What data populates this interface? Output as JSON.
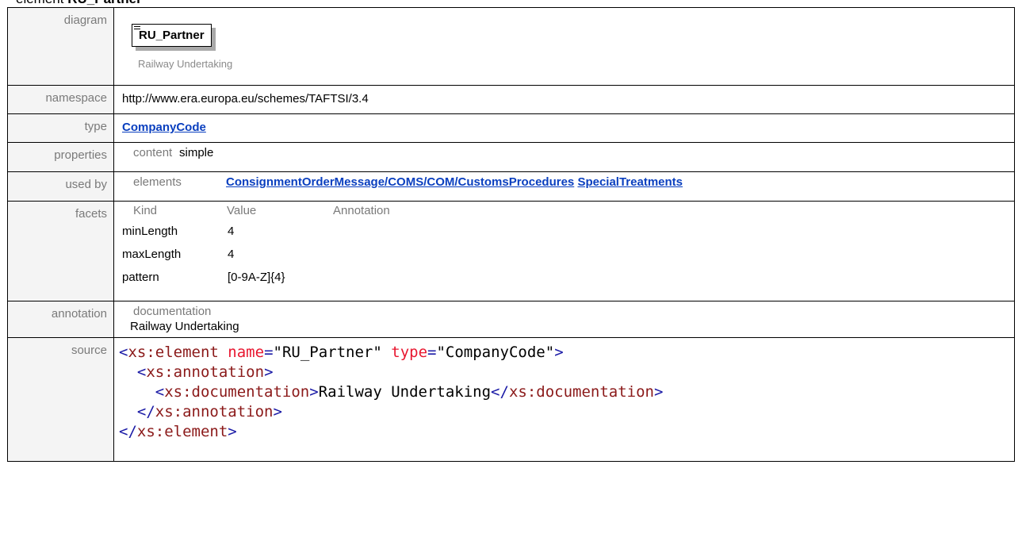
{
  "heading": {
    "prefix": "element",
    "name": "RU_Partner"
  },
  "rows": {
    "diagram": {
      "label": "diagram",
      "box_name": "RU_Partner",
      "caption": "Railway Undertaking"
    },
    "namespace": {
      "label": "namespace",
      "value": "http://www.era.europa.eu/schemes/TAFTSI/3.4"
    },
    "type": {
      "label": "type",
      "value": "CompanyCode"
    },
    "properties": {
      "label": "properties",
      "key": "content",
      "value": "simple"
    },
    "used_by": {
      "label": "used by",
      "key": "elements",
      "links": [
        "ConsignmentOrderMessage/COMS/COM/CustomsProcedures",
        "SpecialTreatments"
      ]
    },
    "facets": {
      "label": "facets",
      "headers": {
        "kind": "Kind",
        "value": "Value",
        "annotation": "Annotation"
      },
      "items": [
        {
          "kind": "minLength",
          "value": "4"
        },
        {
          "kind": "maxLength",
          "value": "4"
        },
        {
          "kind": "pattern",
          "value": "[0-9A-Z]{4}"
        }
      ]
    },
    "annotation": {
      "label": "annotation",
      "key": "documentation",
      "value": "Railway Undertaking"
    },
    "source": {
      "label": "source",
      "line1": {
        "open": "<",
        "el": "xs:element",
        "a1": "name",
        "eq": "=",
        "v1": "\"RU_Partner\"",
        "a2": "type",
        "v2": "\"CompanyCode\"",
        "close": ">"
      },
      "line2": {
        "open": "<",
        "el": "xs:annotation",
        "close": ">"
      },
      "line3": {
        "open": "<",
        "el": "xs:documentation",
        "close": ">",
        "text": "Railway Undertaking",
        "endopen": "</",
        "endel": "xs:documentation",
        "endclose": ">"
      },
      "line4": {
        "open": "</",
        "el": "xs:annotation",
        "close": ">"
      },
      "line5": {
        "open": "</",
        "el": "xs:element",
        "close": ">"
      }
    }
  }
}
